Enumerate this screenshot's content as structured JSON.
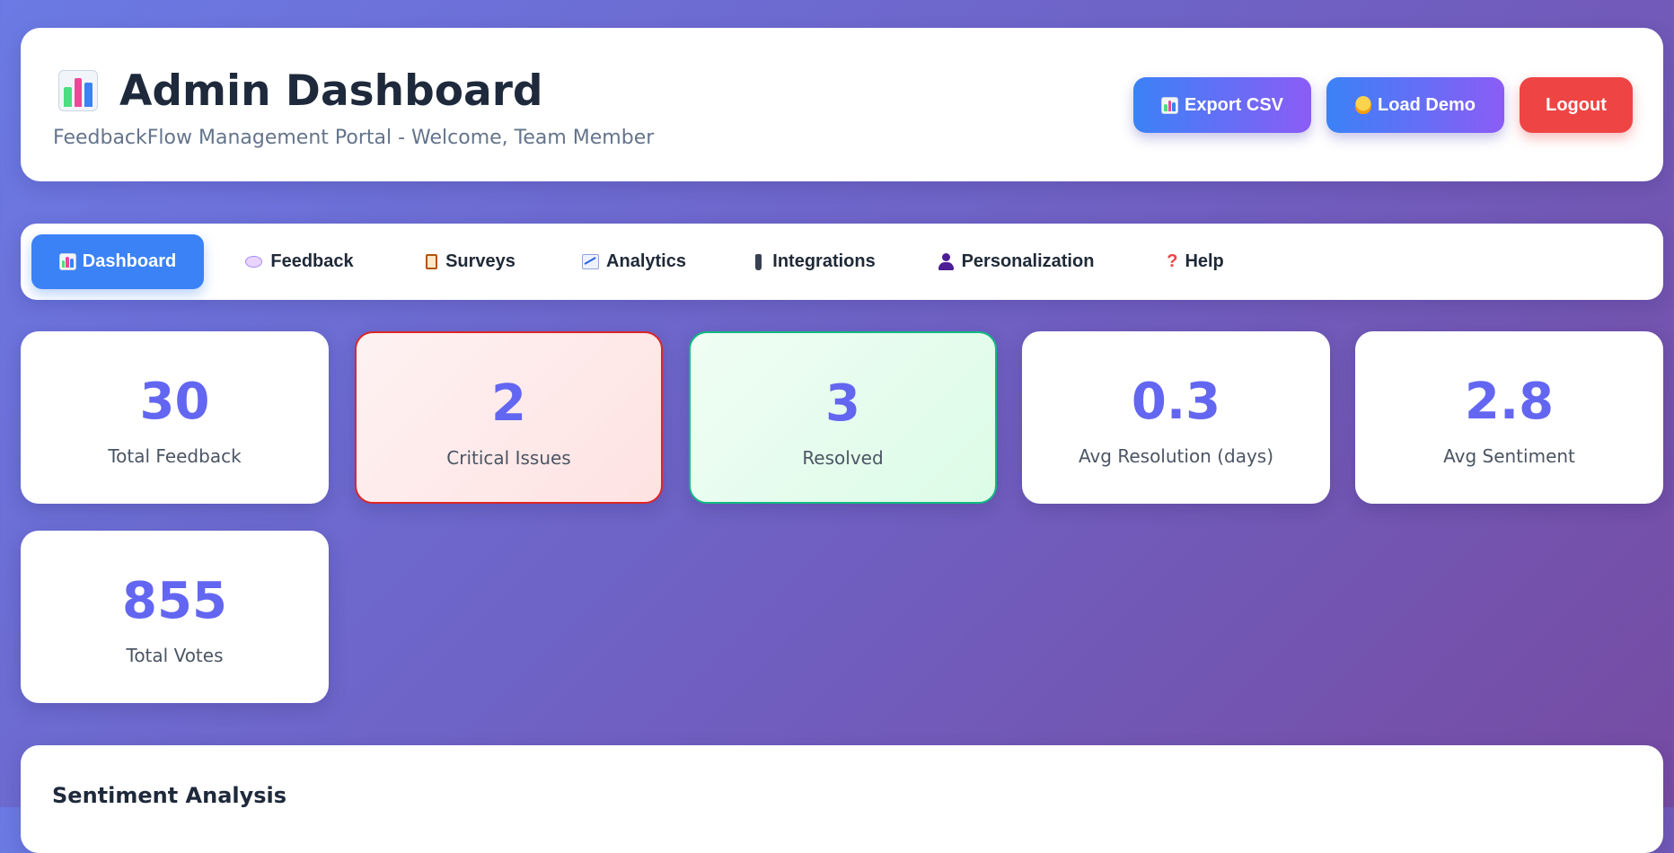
{
  "header": {
    "title": "Admin Dashboard",
    "title_icon": "bar-chart-icon",
    "subtitle": "FeedbackFlow Management Portal - Welcome, Team Member",
    "buttons": {
      "export": "Export CSV",
      "demo": "Load Demo",
      "logout": "Logout"
    }
  },
  "nav": {
    "items": [
      {
        "label": "Dashboard",
        "icon": "bar-chart-icon",
        "active": true
      },
      {
        "label": "Feedback",
        "icon": "speech-bubble-icon"
      },
      {
        "label": "Surveys",
        "icon": "clipboard-icon"
      },
      {
        "label": "Analytics",
        "icon": "trend-chart-icon"
      },
      {
        "label": "Integrations",
        "icon": "plug-icon"
      },
      {
        "label": "Personalization",
        "icon": "person-icon"
      },
      {
        "label": "Help",
        "icon": "question-icon"
      }
    ]
  },
  "stats": [
    {
      "value": "30",
      "label": "Total Feedback"
    },
    {
      "value": "2",
      "label": "Critical Issues"
    },
    {
      "value": "3",
      "label": "Resolved"
    },
    {
      "value": "0.3",
      "label": "Avg Resolution (days)"
    },
    {
      "value": "2.8",
      "label": "Avg Sentiment"
    },
    {
      "value": "855",
      "label": "Total Votes"
    }
  ],
  "sections": {
    "sentiment_title": "Sentiment Analysis"
  },
  "colors": {
    "accent": "#6366f1",
    "primary": "#3b82f6",
    "danger": "#ef4444",
    "success": "#10b981"
  }
}
